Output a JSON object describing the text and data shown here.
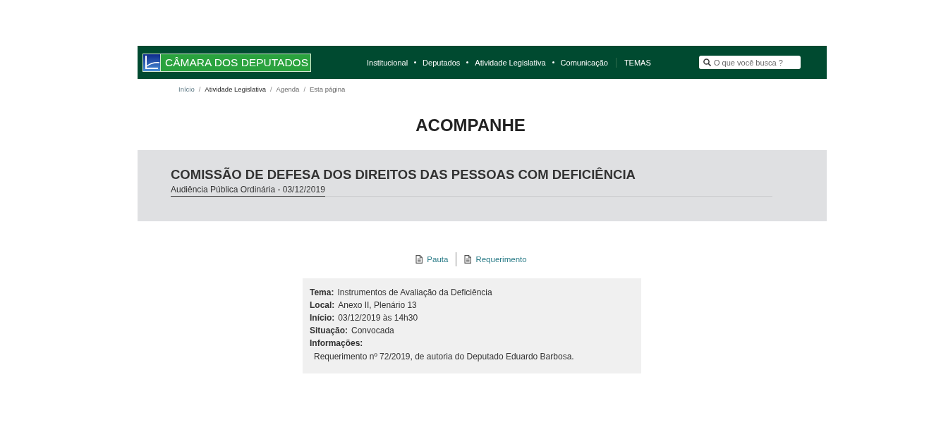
{
  "header": {
    "logo_text": "CÂMARA DOS DEPUTADOS",
    "nav": [
      {
        "label": "Institucional"
      },
      {
        "label": "Deputados"
      },
      {
        "label": "Atividade Legislativa"
      },
      {
        "label": "Comunicação"
      }
    ],
    "themes_link": "TEMAS",
    "search": {
      "placeholder": "O que você busca ?"
    }
  },
  "breadcrumb": {
    "separator": "/",
    "items": [
      {
        "label": "Início",
        "hovered": false
      },
      {
        "label": "Atividade Legislativa",
        "hovered": true
      },
      {
        "label": "Agenda",
        "hovered": false
      },
      {
        "label": "Esta página",
        "hovered": false
      }
    ]
  },
  "page_title": "ACOMPANHE",
  "committee": {
    "name": "COMISSÃO DE DEFESA DOS DIREITOS DAS PESSOAS COM DEFICIÊNCIA",
    "subtitle": "Audiência Pública Ordinária - 03/12/2019"
  },
  "documents": [
    {
      "label": "Pauta"
    },
    {
      "label": "Requerimento"
    }
  ],
  "details": [
    {
      "kind": "inline",
      "label": "Tema:",
      "value": "Instrumentos de Avaliação da Deficiência"
    },
    {
      "kind": "inline",
      "label": "Local:",
      "value": "Anexo II, Plenário 13"
    },
    {
      "kind": "inline",
      "label": "Início:",
      "value": "03/12/2019 às 14h30"
    },
    {
      "kind": "inline",
      "label": "Situação:",
      "value": "Convocada"
    },
    {
      "kind": "block",
      "label": "Informações:",
      "value": "Requerimento nº 72/2019, de autoria do Deputado Eduardo Barbosa."
    }
  ]
}
